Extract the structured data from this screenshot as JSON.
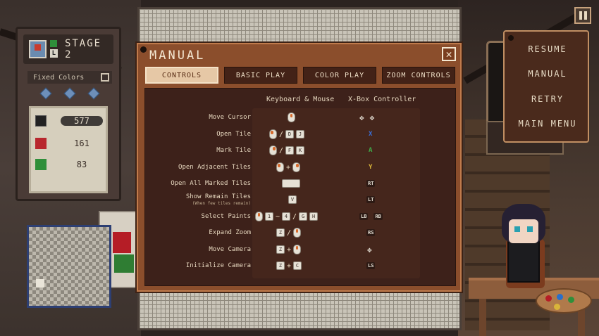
{
  "stage": {
    "title": "STAGE 2",
    "badge_letter": "L",
    "fixed_colors_label": "Fixed Colors",
    "colors": [
      {
        "color": "#222222",
        "count": "577",
        "selected": true
      },
      {
        "color": "#b8272e",
        "count": "161",
        "selected": false
      },
      {
        "color": "#2f8f3a",
        "count": "83",
        "selected": false
      }
    ]
  },
  "manual": {
    "title": "MANUAL",
    "close_icon": "close-icon",
    "tabs": [
      {
        "label": "CONTROLS",
        "active": true
      },
      {
        "label": "BASIC PLAY",
        "active": false
      },
      {
        "label": "COLOR PLAY",
        "active": false
      },
      {
        "label": "ZOOM CONTROLS",
        "active": false
      }
    ],
    "col_keyboard": "Keyboard & Mouse",
    "col_controller": "X-Box Controller",
    "rows": [
      {
        "label": "Move Cursor",
        "sub": ""
      },
      {
        "label": "Open Tile",
        "sub": ""
      },
      {
        "label": "Mark Tile",
        "sub": ""
      },
      {
        "label": "Open Adjacent Tiles",
        "sub": ""
      },
      {
        "label": "Open All Marked Tiles",
        "sub": ""
      },
      {
        "label": "Show Remain Tiles",
        "sub": "(When few tiles remain)"
      },
      {
        "label": "Select Paints",
        "sub": ""
      },
      {
        "label": "Expand Zoom",
        "sub": ""
      },
      {
        "label": "Move Camera",
        "sub": ""
      },
      {
        "label": "Initialize Camera",
        "sub": ""
      }
    ],
    "keys": {
      "open_tile_keys": [
        "D",
        "J"
      ],
      "mark_tile_keys": [
        "F",
        "K"
      ],
      "show_remain_key": "V",
      "select_paint_range": [
        "1",
        "~",
        "4"
      ],
      "select_paint_keys": [
        "G",
        "H"
      ],
      "expand_zoom_key": "Z",
      "move_camera_key": "Z",
      "init_camera_keys": [
        "Z",
        "C"
      ],
      "slash": "/",
      "plus": "+"
    },
    "controller": {
      "open_tile": "X",
      "mark_tile": "A",
      "open_adjacent": "Y",
      "open_all_marked": "RT",
      "show_remain": "LT",
      "select_paints": [
        "LB",
        "RB"
      ],
      "expand_zoom": "RS",
      "init_camera": "LS"
    }
  },
  "pause_menu": {
    "items": [
      "RESUME",
      "MANUAL",
      "RETRY",
      "MAIN MENU"
    ]
  },
  "colors": {
    "controller_x": "#3a6fd8",
    "controller_a": "#3fae4a",
    "controller_y": "#d9b43a"
  }
}
